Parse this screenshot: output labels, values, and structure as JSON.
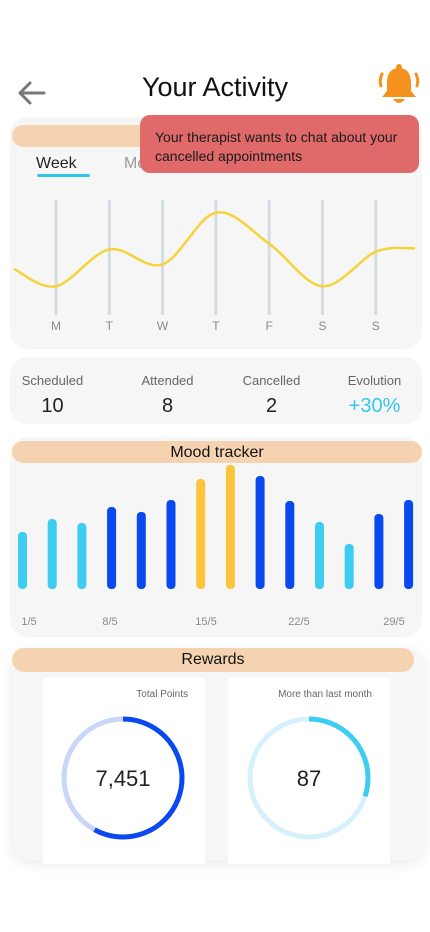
{
  "header": {
    "title": "Your Activity",
    "back_icon": "arrow-left-icon",
    "bell_icon": "bell-icon",
    "bell_color": "#f5921e"
  },
  "toast": {
    "message": "Your therapist wants to chat about your cancelled appointments",
    "color": "#e06a6a"
  },
  "activity": {
    "tabs": [
      "Week",
      "Month"
    ],
    "active_tab": "Week",
    "chart_data": {
      "type": "line",
      "categories": [
        "M",
        "T",
        "W",
        "T",
        "F",
        "S",
        "S"
      ],
      "series": [
        {
          "values": [
            0.25,
            0.57,
            0.44,
            0.89,
            0.62,
            0.25,
            0.55
          ]
        }
      ],
      "ylim": [
        0,
        1
      ],
      "line_color": "#f5d33a",
      "grid": true
    }
  },
  "stats": [
    {
      "label": "Scheduled",
      "value": "10"
    },
    {
      "label": "Attended",
      "value": "8"
    },
    {
      "label": "Cancelled",
      "value": "2"
    },
    {
      "label": "Evolution",
      "value": "+30%"
    }
  ],
  "mood": {
    "title": "Mood tracker",
    "chart_data": {
      "type": "bar",
      "x_ticks": [
        "1/5",
        "8/5",
        "15/5",
        "22/5",
        "29/5"
      ],
      "values": [
        57,
        70,
        66,
        82,
        77,
        89,
        110,
        124,
        113,
        88,
        67,
        45,
        75,
        89
      ],
      "colors": [
        "#3dcdf0",
        "#3dcdf0",
        "#3dcdf0",
        "#0a48f0",
        "#0a48f0",
        "#0a48f0",
        "#fcc43a",
        "#fcc43a",
        "#0a48f0",
        "#0a48f0",
        "#3dcdf0",
        "#3dcdf0",
        "#0a48f0",
        "#0a48f0"
      ]
    }
  },
  "rewards": {
    "title": "Rewards",
    "cards": [
      {
        "caption": "Total Points",
        "value": "7,451",
        "progress": 0.58,
        "color": "#0a48f0",
        "track": "#c9d6f8"
      },
      {
        "caption": "More than last month",
        "value": "87",
        "progress": 0.3,
        "color": "#3dcdf0",
        "track": "#d6f1fb"
      }
    ]
  }
}
